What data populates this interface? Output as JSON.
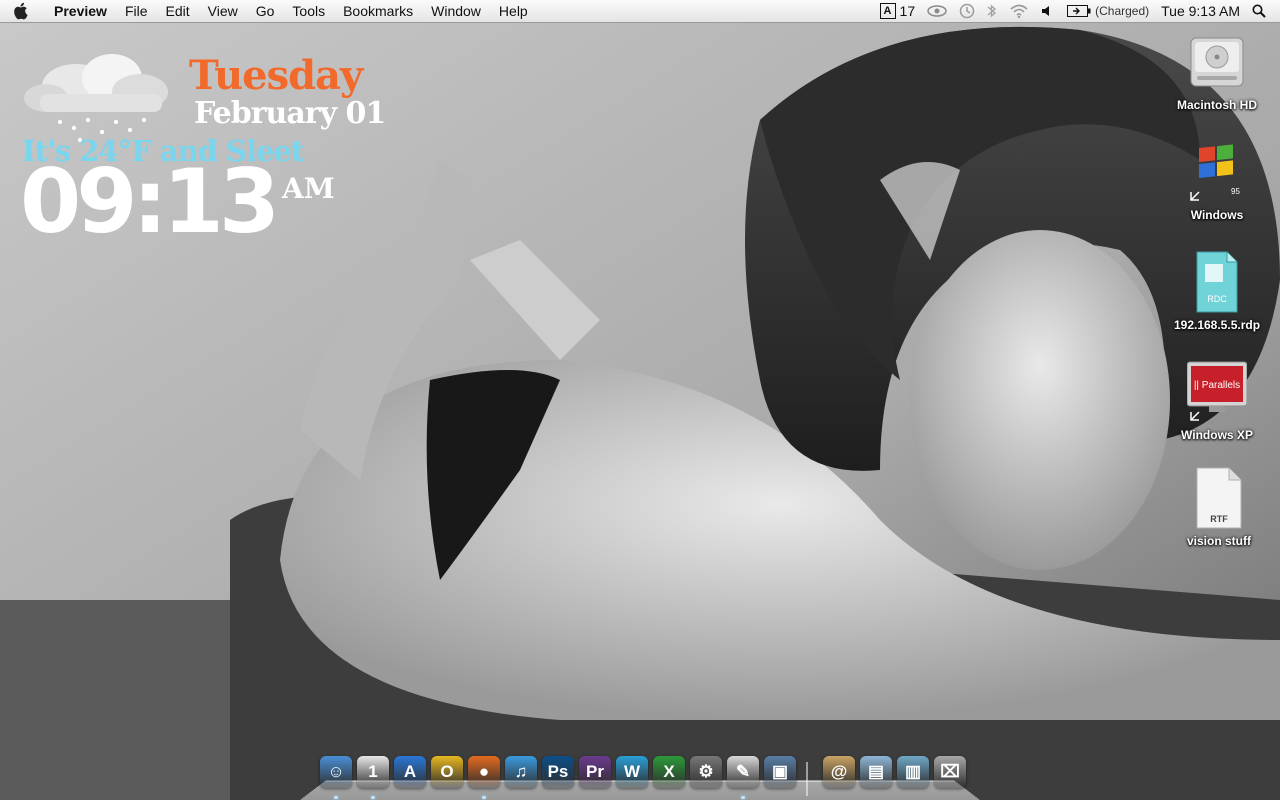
{
  "menubar": {
    "app_name": "Preview",
    "menus": [
      "File",
      "Edit",
      "View",
      "Go",
      "Tools",
      "Bookmarks",
      "Window",
      "Help"
    ],
    "status": {
      "adobe_count": "17",
      "battery": "(Charged)",
      "clock": "Tue 9:13 AM"
    }
  },
  "widget": {
    "day": "Tuesday",
    "date": "February 01",
    "condition": "It's 24°F and Sleet",
    "time": "09:13",
    "ampm": "AM",
    "icon": "sleet-cloud-icon"
  },
  "desktop_icons": [
    {
      "label": "Macintosh HD",
      "icon": "hard-drive-icon"
    },
    {
      "label": "Windows",
      "icon": "windows-95-alias-icon"
    },
    {
      "label": "192.168.5.5.rdp",
      "icon": "rdp-file-icon",
      "badge": "RDC"
    },
    {
      "label": "Windows XP",
      "icon": "parallels-alias-icon",
      "badge": "|| Parallels"
    },
    {
      "label": "vision stuff",
      "icon": "rtf-document-icon",
      "badge": "RTF"
    }
  ],
  "dock": {
    "apps": [
      {
        "name": "finder",
        "glyph": "☺",
        "color": "#4a8fd8"
      },
      {
        "name": "ical",
        "glyph": "1",
        "color": "#e8e8e8"
      },
      {
        "name": "app-store",
        "glyph": "A",
        "color": "#2a78d8"
      },
      {
        "name": "opera",
        "glyph": "O",
        "color": "#e8b820"
      },
      {
        "name": "firefox",
        "glyph": "●",
        "color": "#e46a1e"
      },
      {
        "name": "itunes",
        "glyph": "♫",
        "color": "#3a9be0"
      },
      {
        "name": "photoshop",
        "glyph": "Ps",
        "color": "#0c4f8a"
      },
      {
        "name": "premiere",
        "glyph": "Pr",
        "color": "#6b3b8e"
      },
      {
        "name": "word",
        "glyph": "W",
        "color": "#2aa0d8"
      },
      {
        "name": "excel",
        "glyph": "X",
        "color": "#2c9a3a"
      },
      {
        "name": "system-preferences",
        "glyph": "⚙",
        "color": "#777777"
      },
      {
        "name": "preview",
        "glyph": "✎",
        "color": "#d8d8d8"
      },
      {
        "name": "iphoto",
        "glyph": "▣",
        "color": "#5a7fa8"
      }
    ],
    "stacks": [
      {
        "name": "documents",
        "glyph": "@",
        "color": "#c9a464"
      },
      {
        "name": "folder",
        "glyph": "▤",
        "color": "#8fb7d8"
      },
      {
        "name": "downloads",
        "glyph": "▥",
        "color": "#6fa8c8"
      },
      {
        "name": "trash",
        "glyph": "⌧",
        "color": "#a8a8a8"
      }
    ]
  },
  "colors": {
    "day": "#f26a2b",
    "condition": "#79d6ee",
    "clock": "#ffffff"
  }
}
